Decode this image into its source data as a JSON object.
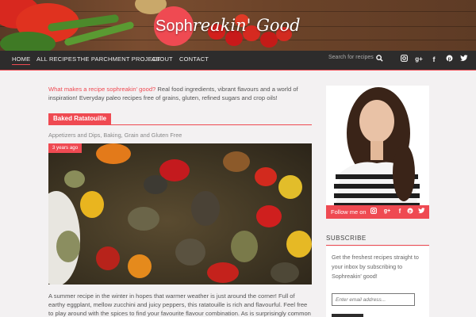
{
  "header": {
    "logo_accent": "Soph",
    "logo_rest": "reakin' Good",
    "accent_color": "#ef4a52"
  },
  "nav": {
    "items": [
      {
        "label": "HOME",
        "active": true
      },
      {
        "label": "ALL RECIPES"
      },
      {
        "label": "THE PARCHMENT PROJECT"
      },
      {
        "label": "ABOUT"
      },
      {
        "label": "CONTACT"
      }
    ],
    "search_placeholder": "Search for recipes",
    "icons": [
      "search-icon",
      "instagram-icon",
      "google-plus-icon",
      "facebook-icon",
      "pinterest-icon",
      "twitter-icon"
    ]
  },
  "intro": {
    "question": "What makes a recipe sophreakin' good?",
    "body": " Real food ingredients, vibrant flavours and a world of inspiration! Everyday paleo recipes free of grains, gluten, refined sugars and crop oils!"
  },
  "post": {
    "title": "Baked Ratatouille",
    "categories": "Appetizers and Dips, Baking, Grain and Gluten Free",
    "date": "3 years ago",
    "excerpt": "A summer recipe in the winter in hopes that warmer weather is just around the corner! Full of earthy eggplant, mellow zucchini and juicy peppers, this ratatouille is rich and flavourful. Feel free to play around with the spices to find your favourite flavour combination. As is surprisingly common here on Sophreakin'"
  },
  "sidebar": {
    "follow_label": "Follow me on",
    "follow_icons": [
      "instagram-icon",
      "google-plus-icon",
      "facebook-icon",
      "pinterest-icon",
      "twitter-icon"
    ],
    "subscribe_title": "SUBSCRIBE",
    "subscribe_text": "Get the freshest recipes straight to your inbox by subscribing to Sophreakin' good!",
    "email_placeholder": "Enter email address..."
  }
}
